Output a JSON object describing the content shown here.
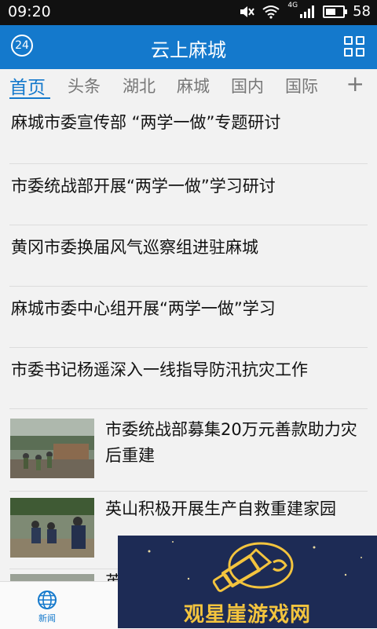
{
  "status_bar": {
    "time": "09:20",
    "network": "4G",
    "battery": "58",
    "battery_level": 0.58,
    "icons": [
      "mute-icon",
      "wifi-icon",
      "signal-icon",
      "battery-icon"
    ]
  },
  "header": {
    "logo_text": "24",
    "title": "云上麻城",
    "menu_icon": "grid-icon",
    "accent": "#1479cc"
  },
  "tabs": {
    "items": [
      "首页",
      "头条",
      "湖北",
      "麻城",
      "国内",
      "国际"
    ],
    "active_index": 0,
    "add_label": "+"
  },
  "news": {
    "text_items": [
      "麻城市委宣传部 “两学一做”专题研讨",
      "市委统战部开展“两学一做”学习研讨",
      "黄冈市委换届风气巡察组进驻麻城",
      "麻城市委中心组开展“两学一做”学习",
      "市委书记杨遥深入一线指导防汛抗灾工作"
    ],
    "image_items": [
      {
        "title": "市委统战部募集20万元善款助力灾后重建"
      },
      {
        "title": "英山积极开展生产自救重建家园"
      }
    ],
    "partial_item": {
      "title": "英"
    }
  },
  "bottom_nav": {
    "news_label": "新闻"
  },
  "watermark": {
    "text": "观星崖游戏网"
  }
}
